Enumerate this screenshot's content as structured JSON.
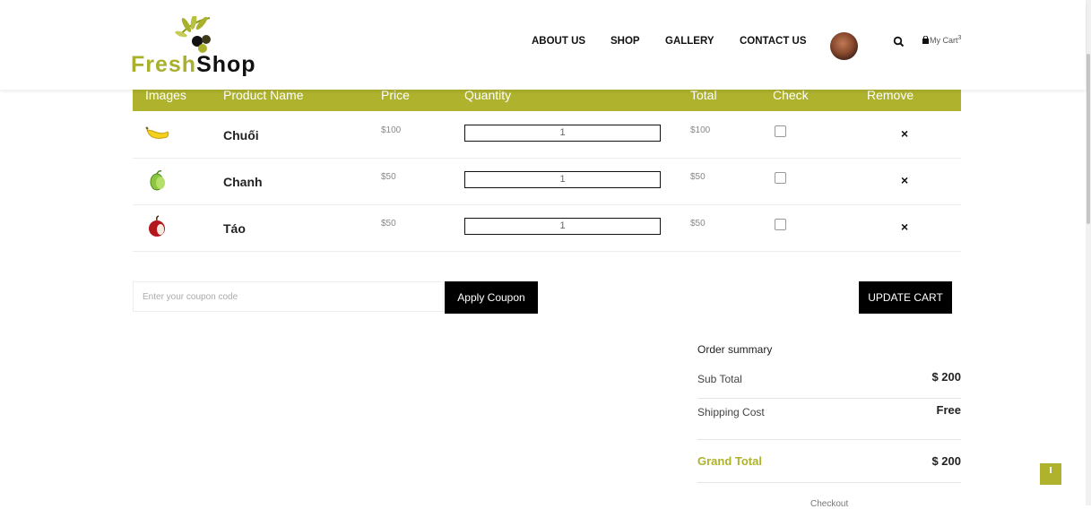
{
  "brand": {
    "fresh": "Fresh",
    "shop": "Shop"
  },
  "nav": {
    "about": "ABOUT US",
    "shop": "SHOP",
    "gallery": "GALLERY",
    "contact": "CONTACT US"
  },
  "cart": {
    "label": "My Cart",
    "count": "3"
  },
  "table": {
    "headers": [
      "Images",
      "Product Name",
      "Price",
      "Quantity",
      "Total",
      "Check",
      "Remove"
    ],
    "rows": [
      {
        "name": "Chuối",
        "price": "$100",
        "qty": "1",
        "total": "$100",
        "icon": "banana-icon"
      },
      {
        "name": "Chanh",
        "price": "$50",
        "qty": "1",
        "total": "$50",
        "icon": "lemon-icon"
      },
      {
        "name": "Táo",
        "price": "$50",
        "qty": "1",
        "total": "$50",
        "icon": "apple-icon"
      }
    ],
    "remove_symbol": "×"
  },
  "coupon": {
    "placeholder": "Enter your coupon code",
    "apply_label": "Apply Coupon"
  },
  "update_label": "UPDATE CART",
  "summary": {
    "title": "Order summary",
    "subtotal_label": "Sub Total",
    "subtotal_value": "$ 200",
    "shipping_label": "Shipping Cost",
    "shipping_value": "Free",
    "grand_label": "Grand Total",
    "grand_value": "$ 200",
    "checkout_label": "Checkout"
  },
  "colors": {
    "accent": "#aeb22d",
    "button": "#000000"
  }
}
